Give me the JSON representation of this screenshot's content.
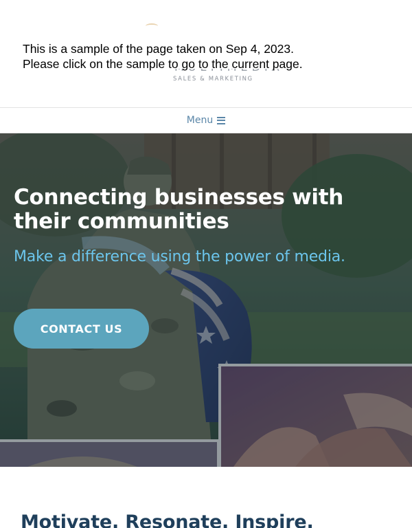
{
  "header": {
    "logo": {
      "wordmark": "MULTIMEDIA",
      "tagline": "SALES & MARKETING"
    },
    "sample_notice": {
      "line1": "This is a sample of the page taken on Sep 4, 2023.",
      "line2": "Please click on the sample to go to the current page."
    }
  },
  "nav": {
    "menu_label": "Menu",
    "menu_icon": "hamburger-icon"
  },
  "hero": {
    "title": "Connecting businesses with their communities",
    "subtitle": "Make a difference using the power of media.",
    "cta_label": "CONTACT US",
    "background": "photo-collage-soldier-and-child-with-flag-and-hands-together"
  },
  "section": {
    "title": "Motivate. Resonate. Inspire."
  },
  "colors": {
    "hero_title": "#ffffff",
    "hero_subtitle": "#6cc5ec",
    "cta_background": "#5ca5bd",
    "menu_text": "#5a86a8",
    "section_title": "#1f3f5b"
  }
}
